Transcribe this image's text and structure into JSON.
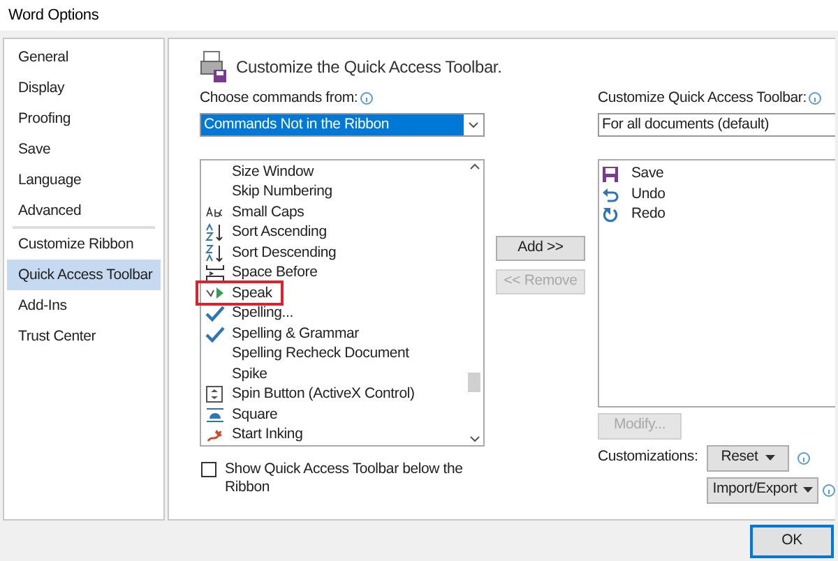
{
  "window": {
    "title": "Word Options"
  },
  "sidebar": {
    "items": [
      {
        "label": "General",
        "selected": false,
        "divider_after": false
      },
      {
        "label": "Display",
        "selected": false,
        "divider_after": false
      },
      {
        "label": "Proofing",
        "selected": false,
        "divider_after": false
      },
      {
        "label": "Save",
        "selected": false,
        "divider_after": false
      },
      {
        "label": "Language",
        "selected": false,
        "divider_after": false
      },
      {
        "label": "Advanced",
        "selected": false,
        "divider_after": true
      },
      {
        "label": "Customize Ribbon",
        "selected": false,
        "divider_after": false
      },
      {
        "label": "Quick Access Toolbar",
        "selected": true,
        "divider_after": false
      },
      {
        "label": "Add-Ins",
        "selected": false,
        "divider_after": false
      },
      {
        "label": "Trust Center",
        "selected": false,
        "divider_after": false
      }
    ]
  },
  "heading": "Customize the Quick Access Toolbar.",
  "choose": {
    "label": "Choose commands from:",
    "value": "Commands Not in the Ribbon"
  },
  "commands": [
    {
      "label": "Size Window",
      "kind": "none",
      "highlighted": false
    },
    {
      "label": "Skip Numbering",
      "kind": "none",
      "highlighted": false
    },
    {
      "label": "Small Caps",
      "kind": "smallcaps",
      "highlighted": false
    },
    {
      "label": "Sort Ascending",
      "kind": "sortasc",
      "highlighted": false
    },
    {
      "label": "Sort Descending",
      "kind": "sortdesc",
      "highlighted": false
    },
    {
      "label": "Space Before",
      "kind": "space",
      "highlighted": false
    },
    {
      "label": "Speak",
      "kind": "speak",
      "highlighted": true
    },
    {
      "label": "Spelling...",
      "kind": "check",
      "highlighted": false
    },
    {
      "label": "Spelling & Grammar",
      "kind": "check",
      "highlighted": false
    },
    {
      "label": "Spelling Recheck Document",
      "kind": "none",
      "highlighted": false
    },
    {
      "label": "Spike",
      "kind": "none",
      "highlighted": false
    },
    {
      "label": "Spin Button (ActiveX Control)",
      "kind": "spin",
      "highlighted": false
    },
    {
      "label": "Square",
      "kind": "square",
      "highlighted": false
    },
    {
      "label": "Start Inking",
      "kind": "ink",
      "highlighted": false
    }
  ],
  "show_below": {
    "label": "Show Quick Access Toolbar below the Ribbon",
    "checked": false
  },
  "add_button": {
    "label": "Add >>",
    "disabled": false
  },
  "remove_button": {
    "label": "<< Remove",
    "disabled": true
  },
  "customize": {
    "label": "Customize Quick Access Toolbar:",
    "value": "For all documents (default)"
  },
  "toolbar_items": [
    {
      "label": "Save",
      "kind": "save"
    },
    {
      "label": "Undo",
      "kind": "undo"
    },
    {
      "label": "Redo",
      "kind": "redo"
    }
  ],
  "modify_button": {
    "label": "Modify...",
    "disabled": true
  },
  "customizations_label": "Customizations:",
  "reset_button": {
    "label": "Reset"
  },
  "import_export_button": {
    "label": "Import/Export"
  },
  "ok_button": {
    "label": "OK"
  }
}
